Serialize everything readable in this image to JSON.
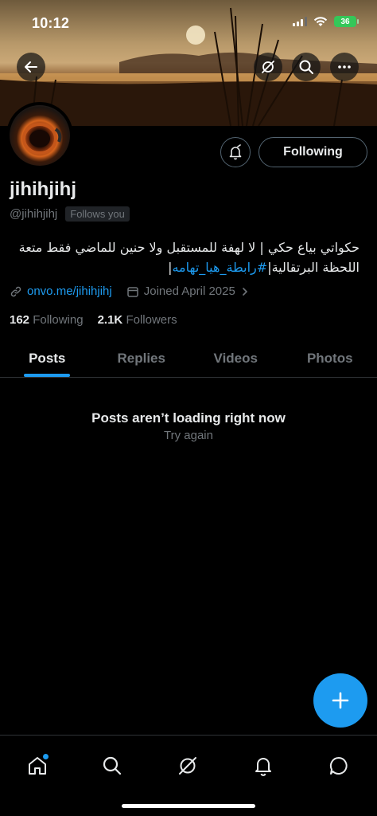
{
  "status_bar": {
    "time": "10:12",
    "battery": "36"
  },
  "profile": {
    "display_name": "jihihjihj",
    "handle": "@jihihjihj",
    "follows_you": "Follows you",
    "bio_text": "حكواتي بياع حكي | لا لهفة للمستقبل ولا حنين للماضي فقط متعة اللحظة البرتقالية|",
    "bio_hashtag": "#رابطة_هيا_تهامه",
    "bio_end": "|",
    "link": "onvo.me/jihihjihj",
    "joined": "Joined April 2025",
    "following_count": "162",
    "following_label": "Following",
    "followers_count": "2.1K",
    "followers_label": "Followers"
  },
  "buttons": {
    "following": "Following"
  },
  "tabs": [
    {
      "label": "Posts",
      "active": true
    },
    {
      "label": "Replies",
      "active": false
    },
    {
      "label": "Videos",
      "active": false
    },
    {
      "label": "Photos",
      "active": false
    }
  ],
  "empty_state": {
    "title": "Posts aren’t loading right now",
    "retry": "Try again"
  },
  "colors": {
    "accent": "#1d9bf0",
    "background": "#000000",
    "muted": "#71767b"
  },
  "icons": {
    "banner": [
      "back-arrow-icon",
      "grok-icon",
      "search-icon",
      "more-icon"
    ],
    "bottom_nav": [
      "home-icon",
      "search-icon",
      "grok-icon",
      "notifications-icon",
      "messages-icon"
    ]
  }
}
